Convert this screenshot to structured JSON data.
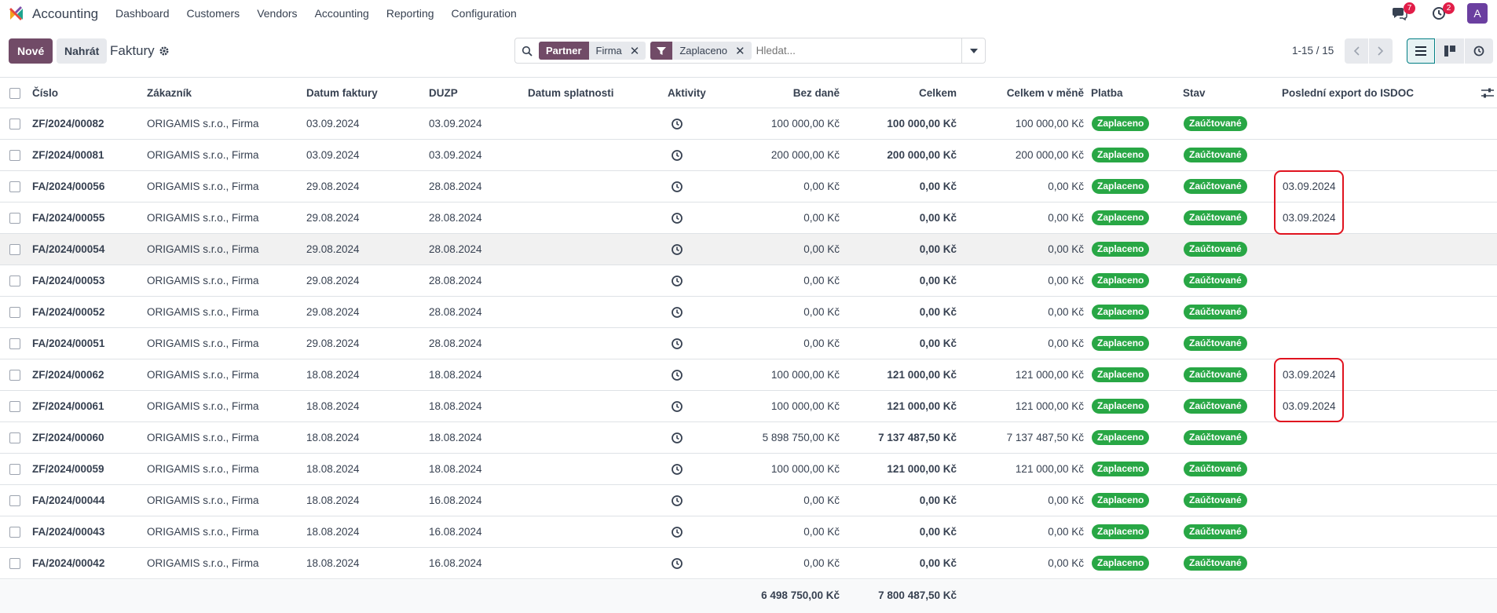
{
  "navbar": {
    "app_name": "Accounting",
    "menu": [
      "Dashboard",
      "Customers",
      "Vendors",
      "Accounting",
      "Reporting",
      "Configuration"
    ],
    "messages_count": "7",
    "activities_count": "2",
    "avatar_letter": "A"
  },
  "control": {
    "new_label": "Nové",
    "upload_label": "Nahrát",
    "breadcrumb": "Faktury",
    "pager": "1-15 / 15"
  },
  "search": {
    "facets": [
      {
        "label": "Partner",
        "value": "Firma"
      },
      {
        "label": "",
        "value": "Zaplaceno"
      }
    ],
    "placeholder": "Hledat..."
  },
  "columns": {
    "number": "Číslo",
    "customer": "Zákazník",
    "invoice_date": "Datum faktury",
    "duzp": "DUZP",
    "due_date": "Datum splatnosti",
    "activities": "Aktivity",
    "untaxed": "Bez daně",
    "total": "Celkem",
    "total_currency": "Celkem v měně",
    "payment": "Platba",
    "state": "Stav",
    "last_export": "Poslední export do ISDOC"
  },
  "rows": [
    {
      "number": "ZF/2024/00082",
      "customer": "ORIGAMIS s.r.o., Firma",
      "invoice_date": "03.09.2024",
      "duzp": "03.09.2024",
      "untaxed": "100 000,00 Kč",
      "total": "100 000,00 Kč",
      "total_currency": "100 000,00 Kč",
      "payment": "Zaplaceno",
      "state": "Zaúčtované",
      "last_export": ""
    },
    {
      "number": "ZF/2024/00081",
      "customer": "ORIGAMIS s.r.o., Firma",
      "invoice_date": "03.09.2024",
      "duzp": "03.09.2024",
      "untaxed": "200 000,00 Kč",
      "total": "200 000,00 Kč",
      "total_currency": "200 000,00 Kč",
      "payment": "Zaplaceno",
      "state": "Zaúčtované",
      "last_export": ""
    },
    {
      "number": "FA/2024/00056",
      "customer": "ORIGAMIS s.r.o., Firma",
      "invoice_date": "29.08.2024",
      "duzp": "28.08.2024",
      "untaxed": "0,00 Kč",
      "total": "0,00 Kč",
      "total_currency": "0,00 Kč",
      "payment": "Zaplaceno",
      "state": "Zaúčtované",
      "last_export": "03.09.2024"
    },
    {
      "number": "FA/2024/00055",
      "customer": "ORIGAMIS s.r.o., Firma",
      "invoice_date": "29.08.2024",
      "duzp": "28.08.2024",
      "untaxed": "0,00 Kč",
      "total": "0,00 Kč",
      "total_currency": "0,00 Kč",
      "payment": "Zaplaceno",
      "state": "Zaúčtované",
      "last_export": "03.09.2024"
    },
    {
      "number": "FA/2024/00054",
      "customer": "ORIGAMIS s.r.o., Firma",
      "invoice_date": "29.08.2024",
      "duzp": "28.08.2024",
      "untaxed": "0,00 Kč",
      "total": "0,00 Kč",
      "total_currency": "0,00 Kč",
      "payment": "Zaplaceno",
      "state": "Zaúčtované",
      "last_export": ""
    },
    {
      "number": "FA/2024/00053",
      "customer": "ORIGAMIS s.r.o., Firma",
      "invoice_date": "29.08.2024",
      "duzp": "28.08.2024",
      "untaxed": "0,00 Kč",
      "total": "0,00 Kč",
      "total_currency": "0,00 Kč",
      "payment": "Zaplaceno",
      "state": "Zaúčtované",
      "last_export": ""
    },
    {
      "number": "FA/2024/00052",
      "customer": "ORIGAMIS s.r.o., Firma",
      "invoice_date": "29.08.2024",
      "duzp": "28.08.2024",
      "untaxed": "0,00 Kč",
      "total": "0,00 Kč",
      "total_currency": "0,00 Kč",
      "payment": "Zaplaceno",
      "state": "Zaúčtované",
      "last_export": ""
    },
    {
      "number": "FA/2024/00051",
      "customer": "ORIGAMIS s.r.o., Firma",
      "invoice_date": "29.08.2024",
      "duzp": "28.08.2024",
      "untaxed": "0,00 Kč",
      "total": "0,00 Kč",
      "total_currency": "0,00 Kč",
      "payment": "Zaplaceno",
      "state": "Zaúčtované",
      "last_export": ""
    },
    {
      "number": "ZF/2024/00062",
      "customer": "ORIGAMIS s.r.o., Firma",
      "invoice_date": "18.08.2024",
      "duzp": "18.08.2024",
      "untaxed": "100 000,00 Kč",
      "total": "121 000,00 Kč",
      "total_currency": "121 000,00 Kč",
      "payment": "Zaplaceno",
      "state": "Zaúčtované",
      "last_export": "03.09.2024"
    },
    {
      "number": "ZF/2024/00061",
      "customer": "ORIGAMIS s.r.o., Firma",
      "invoice_date": "18.08.2024",
      "duzp": "18.08.2024",
      "untaxed": "100 000,00 Kč",
      "total": "121 000,00 Kč",
      "total_currency": "121 000,00 Kč",
      "payment": "Zaplaceno",
      "state": "Zaúčtované",
      "last_export": "03.09.2024"
    },
    {
      "number": "ZF/2024/00060",
      "customer": "ORIGAMIS s.r.o., Firma",
      "invoice_date": "18.08.2024",
      "duzp": "18.08.2024",
      "untaxed": "5 898 750,00 Kč",
      "total": "7 137 487,50 Kč",
      "total_currency": "7 137 487,50 Kč",
      "payment": "Zaplaceno",
      "state": "Zaúčtované",
      "last_export": ""
    },
    {
      "number": "ZF/2024/00059",
      "customer": "ORIGAMIS s.r.o., Firma",
      "invoice_date": "18.08.2024",
      "duzp": "18.08.2024",
      "untaxed": "100 000,00 Kč",
      "total": "121 000,00 Kč",
      "total_currency": "121 000,00 Kč",
      "payment": "Zaplaceno",
      "state": "Zaúčtované",
      "last_export": ""
    },
    {
      "number": "FA/2024/00044",
      "customer": "ORIGAMIS s.r.o., Firma",
      "invoice_date": "18.08.2024",
      "duzp": "16.08.2024",
      "untaxed": "0,00 Kč",
      "total": "0,00 Kč",
      "total_currency": "0,00 Kč",
      "payment": "Zaplaceno",
      "state": "Zaúčtované",
      "last_export": ""
    },
    {
      "number": "FA/2024/00043",
      "customer": "ORIGAMIS s.r.o., Firma",
      "invoice_date": "18.08.2024",
      "duzp": "16.08.2024",
      "untaxed": "0,00 Kč",
      "total": "0,00 Kč",
      "total_currency": "0,00 Kč",
      "payment": "Zaplaceno",
      "state": "Zaúčtované",
      "last_export": ""
    },
    {
      "number": "FA/2024/00042",
      "customer": "ORIGAMIS s.r.o., Firma",
      "invoice_date": "18.08.2024",
      "duzp": "16.08.2024",
      "untaxed": "0,00 Kč",
      "total": "0,00 Kč",
      "total_currency": "0,00 Kč",
      "payment": "Zaplaceno",
      "state": "Zaúčtované",
      "last_export": ""
    }
  ],
  "totals": {
    "untaxed": "6 498 750,00 Kč",
    "total": "7 800 487,50 Kč"
  },
  "colors": {
    "brand": "#714b67",
    "status_green": "#28a745",
    "highlight": "#e0131f"
  }
}
